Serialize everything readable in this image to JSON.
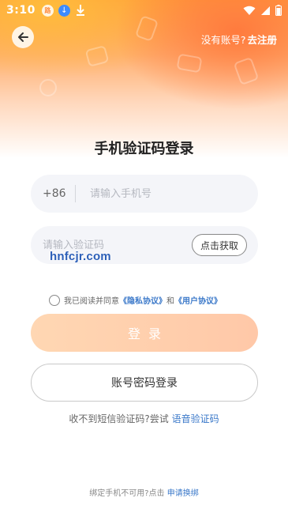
{
  "status_bar": {
    "time": "3:10",
    "badge_text": "路"
  },
  "header": {
    "register_prompt": "没有账号?",
    "register_link": "去注册"
  },
  "title": "手机验证码登录",
  "phone": {
    "prefix": "+86",
    "placeholder": "请输入手机号"
  },
  "code": {
    "placeholder": "请输入验证码",
    "get_code_label": "点击获取"
  },
  "watermark": "hnfcjr.com",
  "agreement": {
    "prefix": "我已阅读并同意",
    "privacy": "《隐私协议》",
    "and": "和",
    "user": "《用户协议》"
  },
  "login_label": "登录",
  "password_login_label": "账号密码登录",
  "voice": {
    "prompt": "收不到短信验证码?尝试",
    "link": "语音验证码"
  },
  "bottom": {
    "prompt": "绑定手机不可用?点击",
    "link": "申请换绑"
  },
  "colors": {
    "accent_orange": "#ff9a3c",
    "link_blue": "#3a78c9",
    "login_button": "#ffc8a8"
  }
}
